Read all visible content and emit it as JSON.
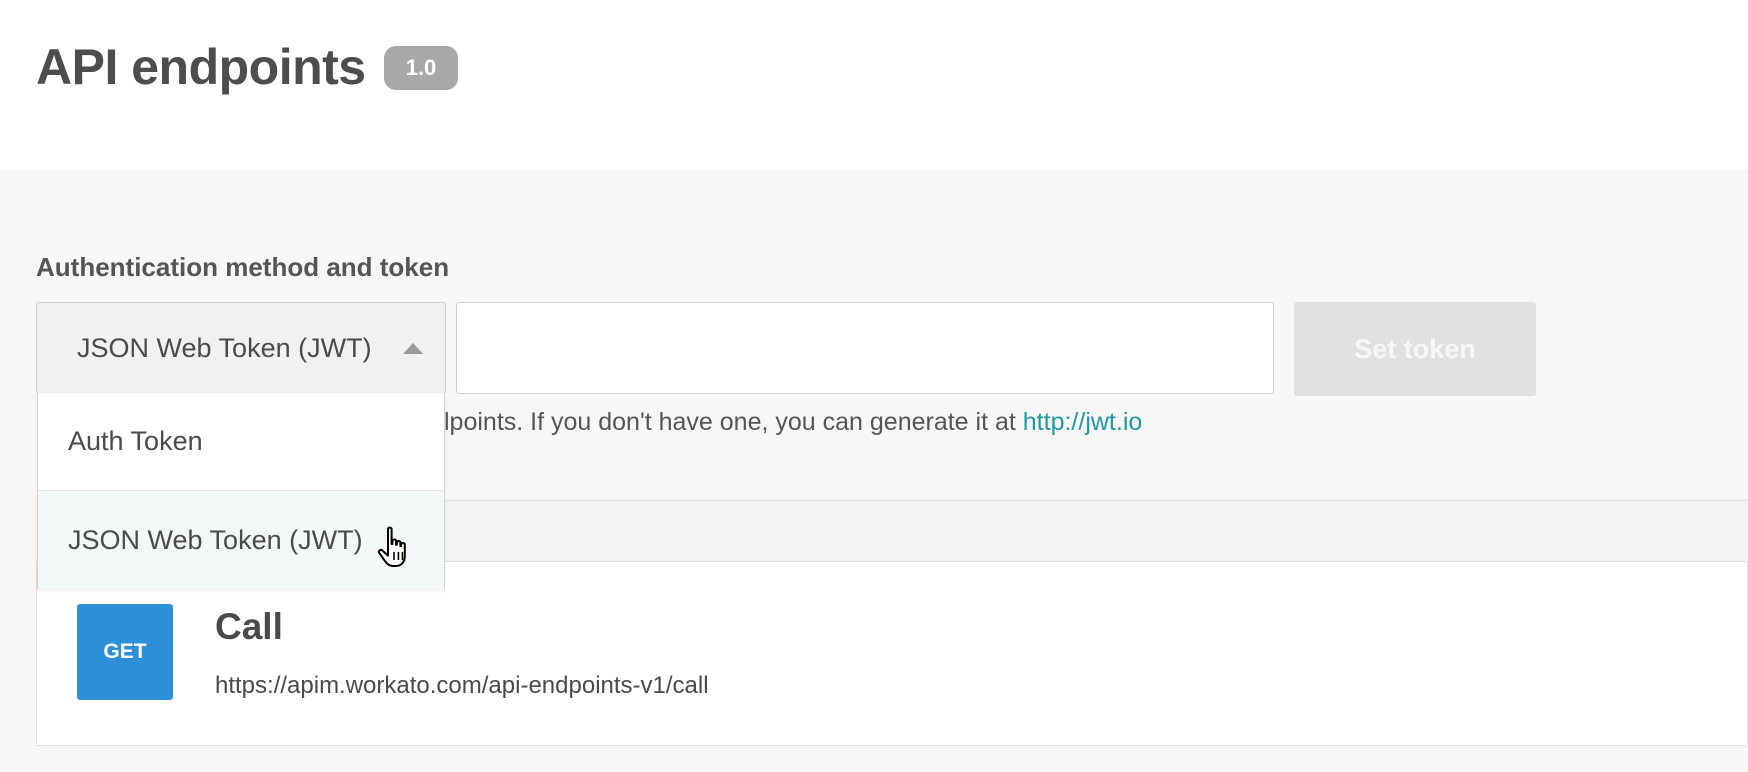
{
  "header": {
    "title": "API endpoints",
    "version": "1.0"
  },
  "auth": {
    "section_label": "Authentication method and token",
    "selected_method": "JSON Web Token (JWT)",
    "token_value": "",
    "set_token_label": "Set token",
    "help_text_prefix": "lpoints. If you don't have one, you can generate it at ",
    "help_link": "http://jwt.io",
    "dropdown_options": [
      {
        "label": "Auth Token",
        "hovered": false
      },
      {
        "label": "JSON Web Token (JWT)",
        "hovered": true
      }
    ]
  },
  "endpoints": [
    {
      "method": "GET",
      "name": "Call",
      "url": "https://apim.workato.com/api-endpoints-v1/call"
    }
  ],
  "colors": {
    "accent_link": "#1e9aa0",
    "get_badge": "#2c90d9",
    "version_badge": "#a8a8a8",
    "set_token_disabled": "#e1e1e1"
  },
  "icons": {
    "select_caret": "caret-up-icon",
    "cursor": "hand-cursor-icon"
  }
}
